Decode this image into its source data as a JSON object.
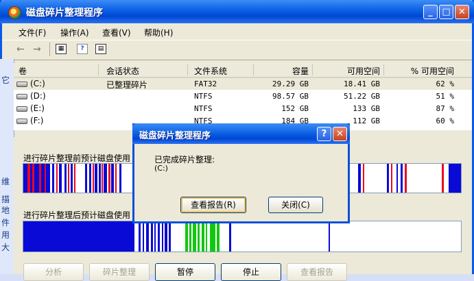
{
  "window": {
    "title": "磁盘碎片整理程序",
    "buttons": {
      "minimize": "_",
      "maximize": "□",
      "close": "✕"
    }
  },
  "menu": [
    {
      "label": "文件(F)"
    },
    {
      "label": "操作(A)"
    },
    {
      "label": "查看(V)"
    },
    {
      "label": "帮助(H)"
    }
  ],
  "toolbar": {
    "back": "←",
    "forward": "→",
    "properties_icon": "properties-icon",
    "help_icon": "help-icon",
    "show_pane_icon": "pane-icon"
  },
  "left_strip_chars": [
    "它",
    "维",
    "描",
    "地",
    "件",
    "用",
    "大"
  ],
  "volumes": {
    "columns": [
      "卷",
      "会话状态",
      "文件系统",
      "容量",
      "可用空间",
      "% 可用空间"
    ],
    "rows": [
      {
        "volume": "(C:)",
        "status": "已整理碎片",
        "fs": "FAT32",
        "capacity": "29.29 GB",
        "free": "18.41 GB",
        "pct": "62 %"
      },
      {
        "volume": "(D:)",
        "status": "",
        "fs": "NTFS",
        "capacity": "98.57 GB",
        "free": "51.22 GB",
        "pct": "51 %"
      },
      {
        "volume": "(E:)",
        "status": "",
        "fs": "NTFS",
        "capacity": "152 GB",
        "free": "133 GB",
        "pct": "87 %"
      },
      {
        "volume": "(F:)",
        "status": "",
        "fs": "NTFS",
        "capacity": "184 GB",
        "free": "112 GB",
        "pct": "60 %"
      }
    ]
  },
  "analysis": {
    "before_label": "进行碎片整理前预计磁盘使用",
    "after_label": "进行碎片整理后预计磁盘使用"
  },
  "bottom_buttons": [
    {
      "label": "分析",
      "enabled": false
    },
    {
      "label": "碎片整理",
      "enabled": false
    },
    {
      "label": "暂停",
      "enabled": true
    },
    {
      "label": "停止",
      "enabled": true
    },
    {
      "label": "查看报告",
      "enabled": false
    }
  ],
  "dialog": {
    "title": "磁盘碎片整理程序",
    "message": "已完成碎片整理:",
    "volume": "(C:)",
    "help_button": "?",
    "close_x": "✕",
    "report_button": "查看报告(R)",
    "close_button": "关闭(C)"
  },
  "colors": {
    "fragmented": "#e8081f",
    "contiguous": "#0a0ad6",
    "system": "#12c80f",
    "free": "#ffffff"
  }
}
